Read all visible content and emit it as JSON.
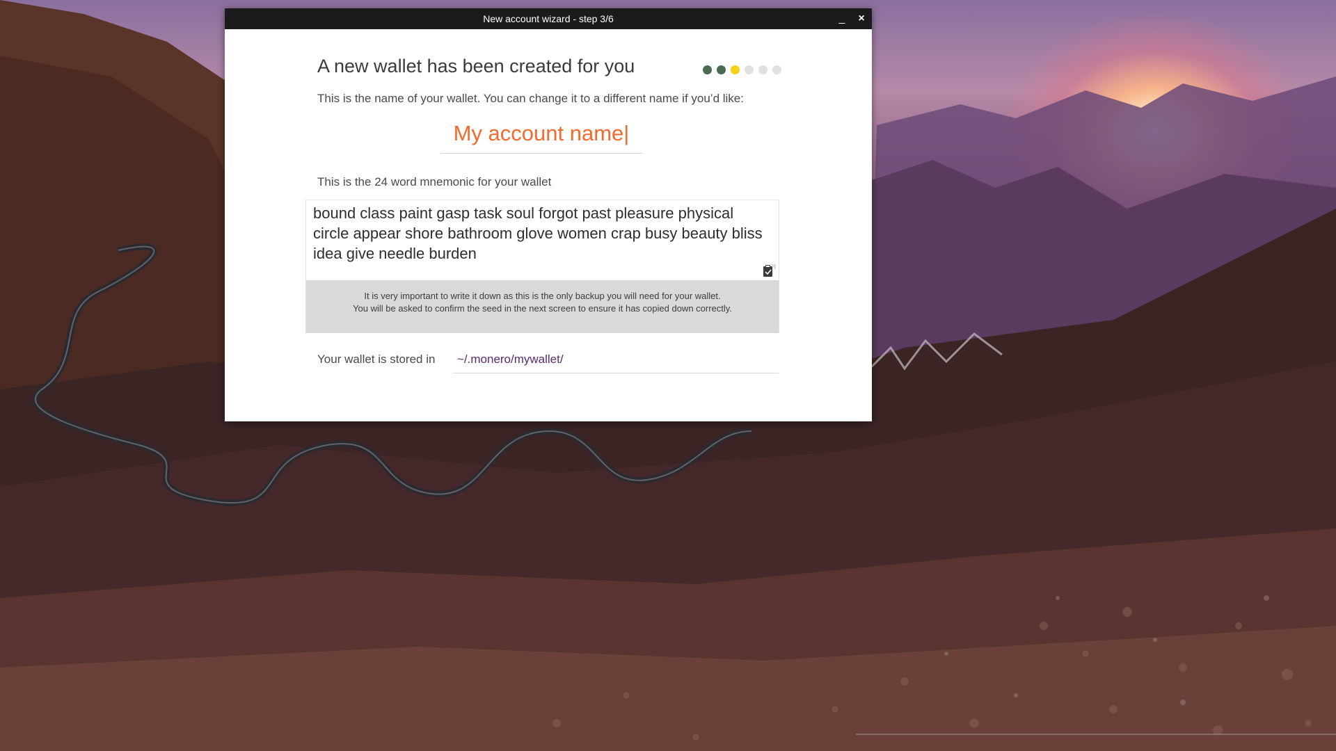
{
  "window": {
    "title": "New account wizard - step 3/6",
    "minimize_label": "_",
    "close_label": "×"
  },
  "wizard": {
    "heading": "A new wallet has been created for you",
    "progress": {
      "current_step": 3,
      "total_steps": 6,
      "dot_colors": [
        "#4a6a52",
        "#4a6a52",
        "#f5d213",
        "#e0e0e0",
        "#e0e0e0",
        "#e0e0e0"
      ]
    },
    "name_prompt": "This is the name of your wallet. You can change it to a different name if you’d like:",
    "account_name": "My account name|",
    "mnemonic_label": "This is the 24 word mnemonic for your wallet",
    "mnemonic": "bound class paint gasp task soul forgot past pleasure physical circle appear shore bathroom glove women crap busy beauty bliss idea give needle burden",
    "mnemonic_note_line1": "It is very important to write it down as this is the only backup you will need for your wallet.",
    "mnemonic_note_line2": "You will be asked to confirm the seed in the next screen to ensure it has copied down correctly.",
    "storage_label": "Your wallet is stored in",
    "storage_path": "~/.monero/mywallet/"
  },
  "icons": {
    "back": "chevron-left-icon",
    "next": "chevron-right-icon",
    "clipboard": "clipboard-icon"
  },
  "colors": {
    "accent": "#f26a2e",
    "path": "#5b2a6e",
    "titlebar": "#1b1b1b"
  }
}
